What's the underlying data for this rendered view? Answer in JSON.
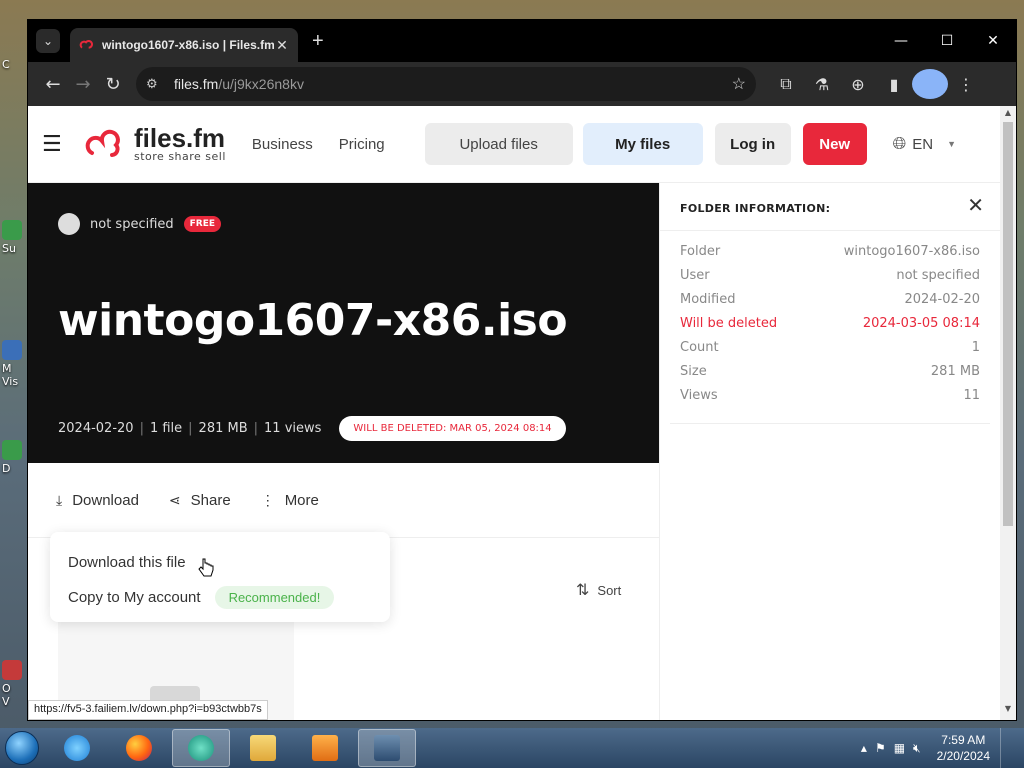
{
  "desktop": {
    "icon_labels": [
      "C",
      "Su",
      "M",
      "Vis",
      "D",
      "O",
      "V"
    ]
  },
  "browser": {
    "tab": {
      "title": "wintogo1607-x86.iso | Files.fm"
    },
    "address": {
      "host": "files.fm",
      "path": "/u/j9kx26n8kv"
    },
    "status_url": "https://fv5-3.failiem.lv/down.php?i=b93ctwbb7s"
  },
  "site": {
    "logo": {
      "name": "files.fm",
      "tagline": "store share sell"
    },
    "nav": {
      "business": "Business",
      "pricing": "Pricing"
    },
    "buttons": {
      "upload": "Upload files",
      "my_files": "My files",
      "login": "Log in",
      "new": "New"
    },
    "language": "EN"
  },
  "hero": {
    "owner": "not specified",
    "badge": "FREE",
    "title": "wintogo1607-x86.iso",
    "meta": {
      "date": "2024-02-20",
      "files": "1 file",
      "size": "281 MB",
      "views": "11 views"
    },
    "delete_notice": "WILL BE DELETED: MAR 05, 2024 08:14"
  },
  "actions": {
    "download": "Download",
    "share": "Share",
    "more": "More",
    "sort": "Sort"
  },
  "dropdown": {
    "download_file": "Download this file",
    "copy_account": "Copy to My account",
    "recommended": "Recommended!"
  },
  "panel": {
    "title": "FOLDER INFORMATION:",
    "rows": [
      {
        "label": "Folder",
        "value": "wintogo1607-x86.iso"
      },
      {
        "label": "User",
        "value": "not specified"
      },
      {
        "label": "Modified",
        "value": "2024-02-20"
      },
      {
        "label": "Will be deleted",
        "value": "2024-03-05 08:14"
      },
      {
        "label": "Count",
        "value": "1"
      },
      {
        "label": "Size",
        "value": "281 MB"
      },
      {
        "label": "Views",
        "value": "11"
      }
    ]
  },
  "taskbar": {
    "time": "7:59 AM",
    "date": "2/20/2024"
  },
  "colors": {
    "brand_red": "#e8283b",
    "my_files_bg": "#e2eefc",
    "recommended_green": "#4ab24a"
  }
}
